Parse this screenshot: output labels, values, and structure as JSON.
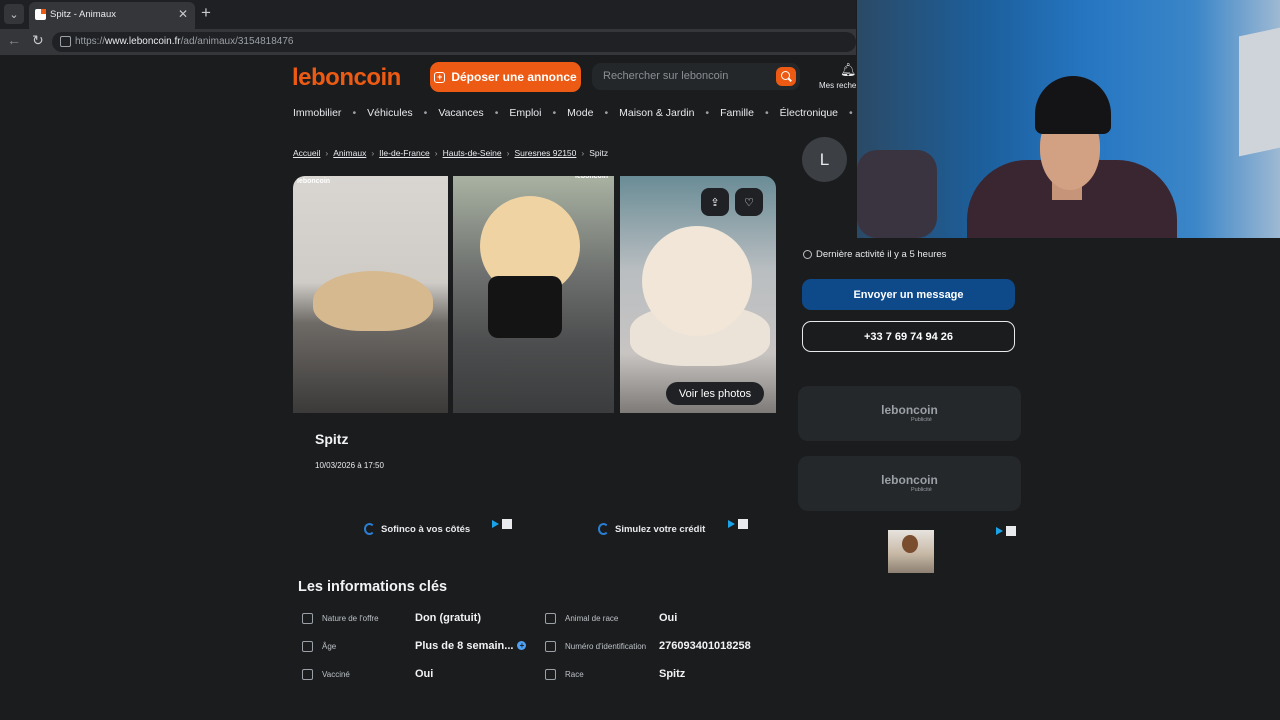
{
  "browser": {
    "tab_title": "Spitz - Animaux",
    "url_prefix": "https://",
    "url_host": "www.leboncoin.fr",
    "url_path": "/ad/animaux/3154818476"
  },
  "header": {
    "logo": "leboncoin",
    "deposit_label": "Déposer une annonce",
    "search_placeholder": "Rechercher sur leboncoin",
    "saved_searches": "Mes reche"
  },
  "categories": [
    "Immobilier",
    "Véhicules",
    "Vacances",
    "Emploi",
    "Mode",
    "Maison & Jardin",
    "Famille",
    "Électronique"
  ],
  "breadcrumb": [
    "Accueil",
    "Animaux",
    "Ile-de-France",
    "Hauts-de-Seine",
    "Suresnes 92150",
    "Spitz"
  ],
  "gallery": {
    "watermark": "leboncoin",
    "see_photos": "Voir les photos"
  },
  "ad": {
    "title": "Spitz",
    "date": "10/03/2026 à 17:50"
  },
  "promos": [
    "Sofinco à vos côtés",
    "Simulez votre crédit"
  ],
  "key_info": {
    "title": "Les informations clés",
    "rows": [
      {
        "label": "Nature de l'offre",
        "value": "Don (gratuit)"
      },
      {
        "label": "Animal de race",
        "value": "Oui"
      },
      {
        "label": "Âge",
        "value": "Plus de 8 semain..."
      },
      {
        "label": "Numéro d'identification",
        "value": "276093401018258"
      },
      {
        "label": "Vacciné",
        "value": "Oui"
      },
      {
        "label": "Race",
        "value": "Spitz"
      }
    ]
  },
  "seller": {
    "initial": "L",
    "activity": "Dernière activité il y a 5 heures",
    "send_message": "Envoyer un message",
    "phone": "+33 7 69 74 94 26"
  },
  "sidebar_ads": {
    "brand": "leboncoin",
    "label": "Publicité"
  },
  "colors": {
    "brand_orange": "#ec5a13",
    "send_button": "#0e4a8a",
    "page_bg": "#1a1c1e"
  },
  "icons": [
    "search-icon",
    "bell-icon",
    "share-icon",
    "heart-icon",
    "clock-icon",
    "reload-icon",
    "back-arrow-icon",
    "close-icon",
    "plus-icon"
  ]
}
